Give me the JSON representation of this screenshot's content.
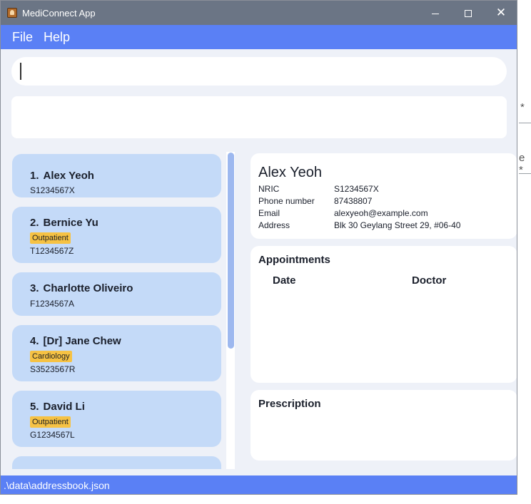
{
  "window": {
    "title": "MediConnect App",
    "controls": {
      "minimize": "",
      "maximize": "",
      "close": "✕"
    }
  },
  "menu": {
    "file": "File",
    "help": "Help"
  },
  "command": {
    "value": ""
  },
  "result": {
    "text": ""
  },
  "persons": [
    {
      "index": "1.",
      "name": "Alex Yeoh",
      "tag": "",
      "nric": "S1234567X"
    },
    {
      "index": "2.",
      "name": "Bernice Yu",
      "tag": "Outpatient",
      "nric": "T1234567Z"
    },
    {
      "index": "3.",
      "name": "Charlotte Oliveiro",
      "tag": "",
      "nric": "F1234567A"
    },
    {
      "index": "4.",
      "name": "[Dr] Jane Chew",
      "tag": "Cardiology",
      "nric": "S3523567R"
    },
    {
      "index": "5.",
      "name": "David Li",
      "tag": "Outpatient",
      "nric": "G1234567L"
    }
  ],
  "detail": {
    "name": "Alex Yeoh",
    "fields": [
      {
        "label": "NRIC",
        "value": "S1234567X"
      },
      {
        "label": "Phone number",
        "value": "87438807"
      },
      {
        "label": "Email",
        "value": "alexyeoh@example.com"
      },
      {
        "label": "Address",
        "value": "Blk 30 Geylang Street 29, #06-40"
      }
    ]
  },
  "appointments": {
    "title": "Appointments",
    "columns": [
      "Date",
      "Doctor"
    ]
  },
  "prescription": {
    "title": "Prescription"
  },
  "status": {
    "path": ".\\data\\addressbook.json"
  },
  "background_window": {
    "fragment1": "*",
    "fragment2": "e *"
  },
  "colors": {
    "titlebar": "#6b7585",
    "accent": "#5a80f5",
    "card": "#c4daf8",
    "tag": "#f6c244",
    "background": "#eef1f8"
  }
}
